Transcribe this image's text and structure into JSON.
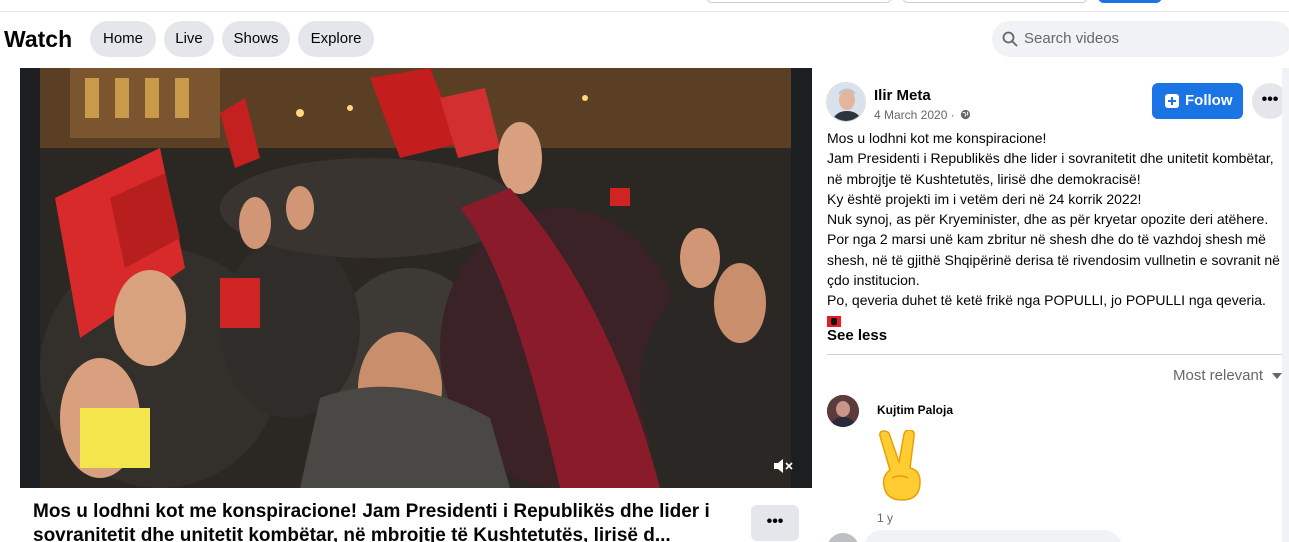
{
  "header": {
    "title": "Watch",
    "nav": [
      "Home",
      "Live",
      "Shows",
      "Explore"
    ],
    "search_placeholder": "Search videos"
  },
  "video": {
    "title": "Mos u lodhni kot me konspiracione! Jam Presidenti i Republikës dhe lider i sovranitetit dhe unitetit kombëtar, në mbrojtje të Kushtetutës, lirisë d..."
  },
  "post": {
    "author": "Ilir Meta",
    "date": "4 March 2020 ·",
    "follow_label": "Follow",
    "text": [
      "Mos u lodhni kot me konspiracione!",
      "Jam Presidenti i Republikës dhe lider i sovranitetit dhe unitetit kombëtar, në mbrojtje të Kushtetutës, lirisë dhe demokracisë!",
      "Ky është projekti im i vetëm deri në 24 korrik 2022!",
      "Nuk synoj, as për Kryeminister, dhe as për kryetar opozite deri atëhere. Por nga 2 marsi unë kam zbritur në shesh dhe do të vazhdoj shesh më shesh, në të gjithë Shqipërinë derisa të rivendosim vullnetin e sovranit në çdo institucion.",
      "Po, qeveria duhet të ketë frikë nga POPULLI, jo POPULLI nga qeveria."
    ],
    "see_less": "See less"
  },
  "comments": {
    "sort_label": "Most relevant",
    "items": [
      {
        "author": "Kujtim Paloja",
        "time": "1 y",
        "emoji": "victory-hand"
      }
    ]
  },
  "colors": {
    "accent": "#1b74e4",
    "pill": "#e4e6eb",
    "muted": "#65676b"
  }
}
